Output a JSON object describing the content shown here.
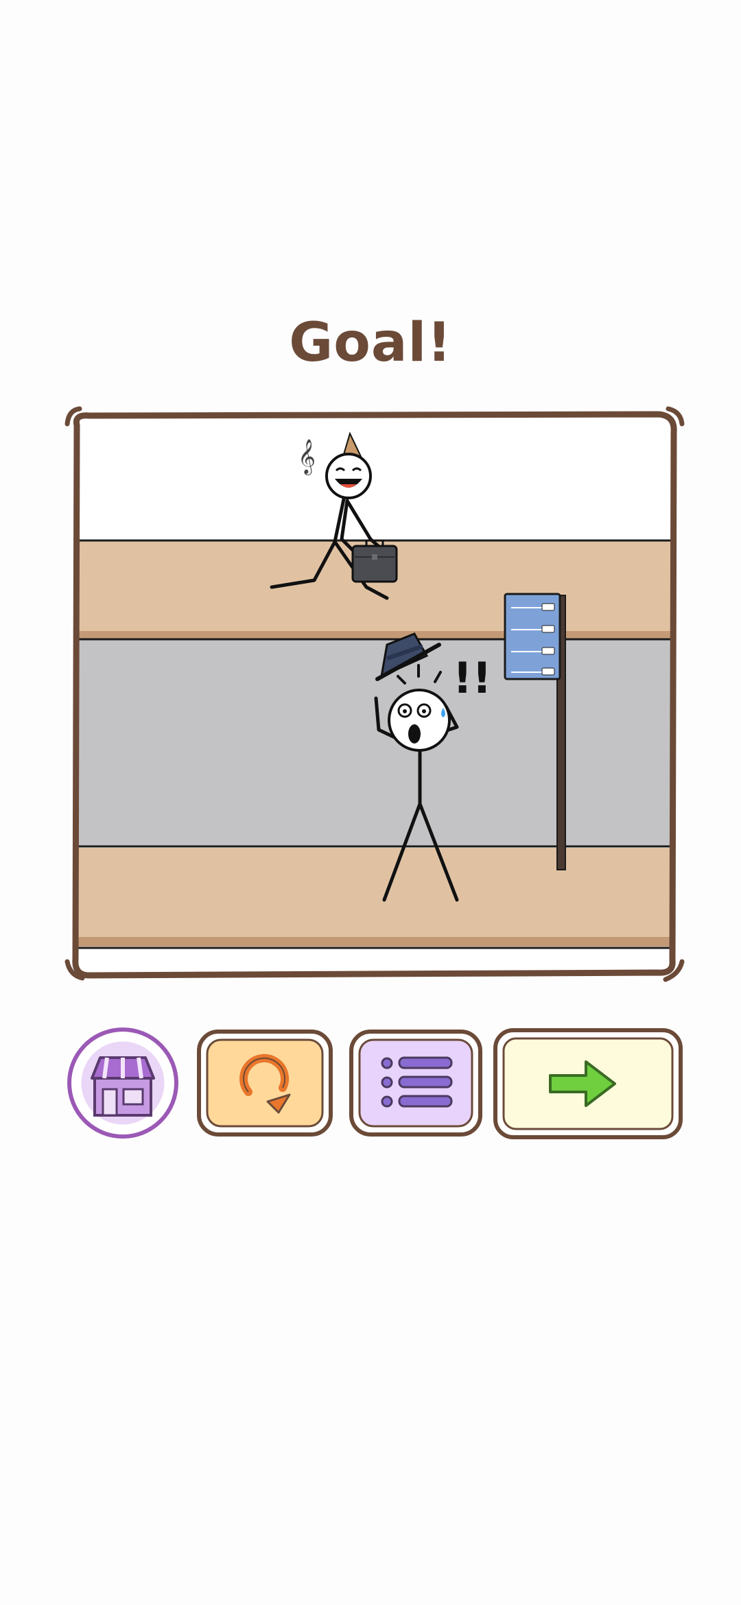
{
  "result": {
    "title": "Goal!"
  },
  "scene": {
    "music_note": "𝄞",
    "exclamation": "!!"
  },
  "buttons": {
    "shop_icon": "shop-icon",
    "restart_icon": "restart-icon",
    "level_list_icon": "list-icon",
    "next_icon": "arrow-right-icon"
  },
  "colors": {
    "frame": "#6b4a38",
    "sidewalk": "#e0c2a3",
    "curb": "#c49a76",
    "road": "#c3c3c5",
    "sign": "#7ea2d8",
    "shop_accent": "#9b59b6",
    "restart_bg": "#ffd89a",
    "restart_accent": "#e9762b",
    "list_bg": "#e7d3fb",
    "list_accent": "#8a6bd1",
    "next_bg": "#fdfbdc",
    "next_accent": "#6fcf3f"
  }
}
